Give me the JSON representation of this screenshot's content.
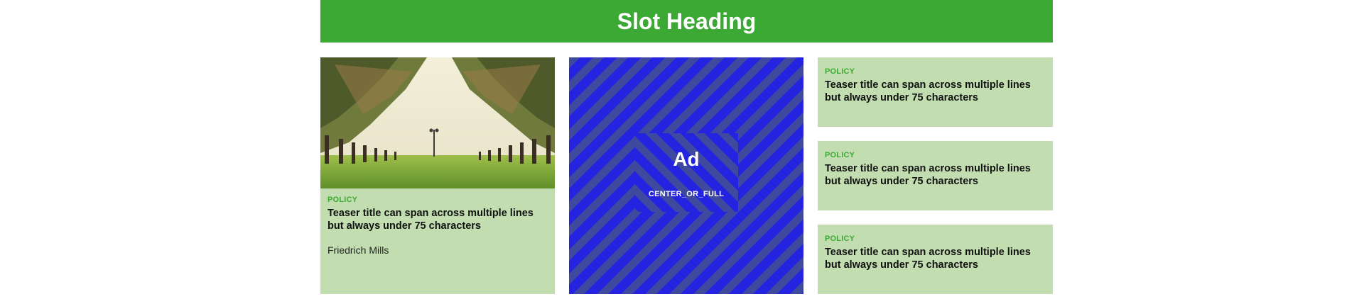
{
  "slot": {
    "heading": "Slot Heading"
  },
  "main_teaser": {
    "category": "POLICY",
    "title": "Teaser title can span across multiple lines but always under 75 characters",
    "author": "Friedrich Mills"
  },
  "ad": {
    "label": "Ad",
    "size_name": "CENTER_OR_FULL"
  },
  "side_teasers": [
    {
      "category": "POLICY",
      "title": "Teaser title can span across multiple lines but always under 75 characters"
    },
    {
      "category": "POLICY",
      "title": "Teaser title can span across multiple lines but always under 75 characters"
    },
    {
      "category": "POLICY",
      "title": "Teaser title can span across multiple lines but always under 75 characters"
    }
  ],
  "colors": {
    "brand_green": "#3da935",
    "card_bg": "#c2deb0",
    "ad_blue": "#2323e0",
    "ad_stripe": "#3f4a9e"
  }
}
